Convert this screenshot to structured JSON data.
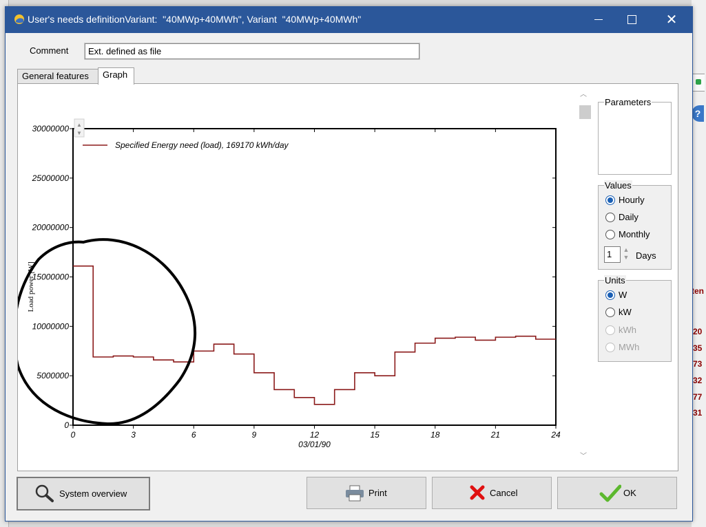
{
  "window": {
    "title": "User's needs definitionVariant:  \"40MWp+40MWh\", Variant  \"40MWp+40MWh\""
  },
  "comment": {
    "label": "Comment",
    "value": "Ext. defined as file"
  },
  "tabs": [
    {
      "label": "General features",
      "active": false
    },
    {
      "label": "Graph",
      "active": true
    }
  ],
  "parameters": {
    "title": "Parameters"
  },
  "values": {
    "title": "Values",
    "options": [
      {
        "label": "Hourly",
        "selected": true
      },
      {
        "label": "Daily",
        "selected": false
      },
      {
        "label": "Monthly",
        "selected": false
      }
    ],
    "days_value": "1",
    "days_label": "Days"
  },
  "units": {
    "title": "Units",
    "options": [
      {
        "label": "W",
        "selected": true,
        "enabled": true
      },
      {
        "label": "kW",
        "selected": false,
        "enabled": true
      },
      {
        "label": "kWh",
        "selected": false,
        "enabled": false
      },
      {
        "label": "MWh",
        "selected": false,
        "enabled": false
      }
    ]
  },
  "buttons": {
    "system_overview": "System overview",
    "print": "Print",
    "cancel": "Cancel",
    "ok": "OK"
  },
  "background": {
    "right_title_fragment": "ten",
    "right_numbers": [
      "20",
      "35",
      "73",
      "32",
      "77",
      "31"
    ],
    "help_glyph": "?"
  },
  "colors": {
    "titlebar": "#2b579a",
    "series": "#8b1a1a",
    "annotation": "#000000",
    "radio_selected": "#1a5fb4",
    "cancel_icon": "#e01010",
    "ok_icon": "#5cb82e"
  },
  "chart_data": {
    "type": "line",
    "step": true,
    "title": "",
    "xlabel": "03/01/90",
    "ylabel": "Load power [W]",
    "xlim": [
      0,
      24
    ],
    "ylim": [
      0,
      30000000
    ],
    "x_ticks": [
      0,
      3,
      6,
      9,
      12,
      15,
      18,
      21,
      24
    ],
    "y_ticks": [
      0,
      5000000,
      10000000,
      15000000,
      20000000,
      25000000,
      30000000
    ],
    "x_tick_labels": [
      "0",
      "3",
      "6",
      "9",
      "12",
      "15",
      "18",
      "21",
      "24"
    ],
    "y_tick_labels": [
      "0",
      "5000000",
      "10000000",
      "15000000",
      "20000000",
      "25000000",
      "30000000"
    ],
    "grid": false,
    "legend_position": "top-left",
    "series": [
      {
        "name": "Specified Energy need (load),  169170 kWh/day",
        "color": "#8b1a1a",
        "x": [
          0,
          1,
          2,
          3,
          4,
          5,
          6,
          7,
          8,
          9,
          10,
          11,
          12,
          13,
          14,
          15,
          16,
          17,
          18,
          19,
          20,
          21,
          22,
          23
        ],
        "values": [
          16100000,
          6900000,
          7000000,
          6900000,
          6600000,
          6400000,
          7500000,
          8200000,
          7200000,
          5300000,
          3600000,
          2800000,
          2100000,
          3600000,
          5300000,
          5000000,
          7400000,
          8300000,
          8800000,
          8900000,
          8600000,
          8900000,
          9000000,
          8700000
        ]
      }
    ]
  }
}
